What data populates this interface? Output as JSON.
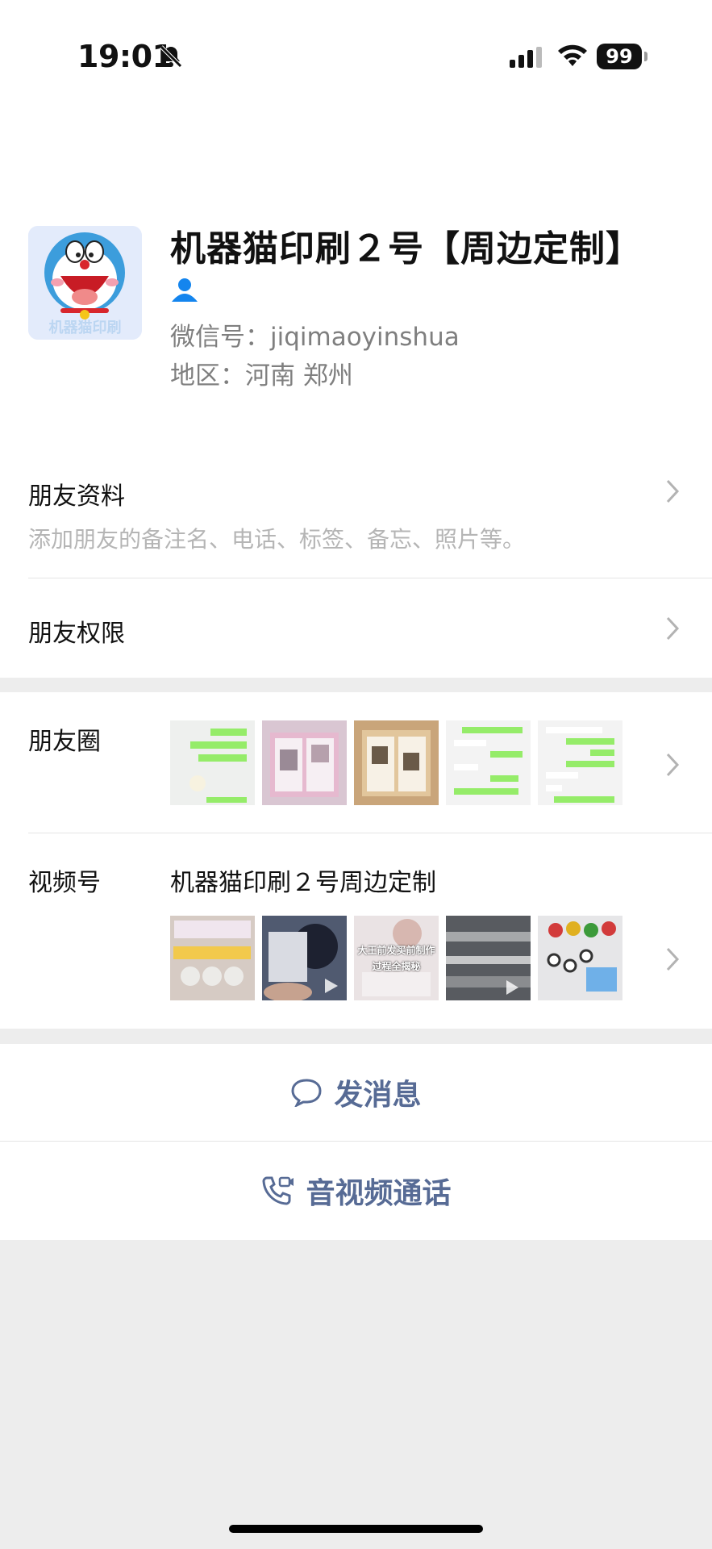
{
  "status": {
    "time": "19:01",
    "battery": "99"
  },
  "profile": {
    "name": "机器猫印刷２号【周边定制】",
    "wechat_id": "微信号：jiqimaoyinshua",
    "region": "地区：河南 郑州",
    "avatar_text": "机器猫印刷"
  },
  "friend_info": {
    "title": "朋友资料",
    "subtitle": "添加朋友的备注名、电话、标签、备忘、照片等。"
  },
  "permissions": {
    "title": "朋友权限"
  },
  "moments": {
    "title": "朋友圈",
    "thumb_texts": [
      "大王前发买前制作",
      "过程全揭秘"
    ]
  },
  "channels": {
    "title": "视频号",
    "name": "机器猫印刷２号周边定制",
    "thumb_texts": [
      "大王前发买前制作",
      "过程全揭秘"
    ]
  },
  "actions": {
    "message": "发消息",
    "call": "音视频通话"
  },
  "colors": {
    "link": "#576b95",
    "bg": "#ededed",
    "verified": "#1485ee"
  }
}
